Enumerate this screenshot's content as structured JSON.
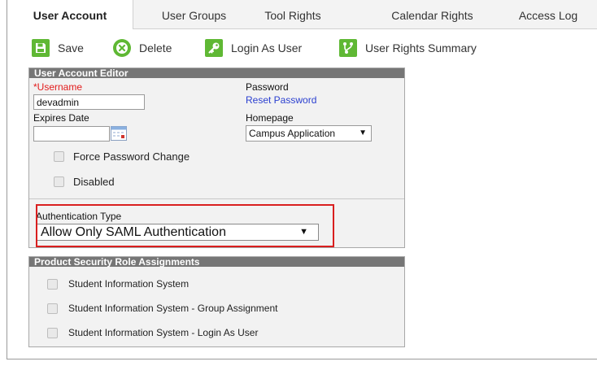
{
  "tabs": [
    {
      "label": "User Account",
      "active": true
    },
    {
      "label": "User Groups",
      "active": false
    },
    {
      "label": "Tool Rights",
      "active": false
    },
    {
      "label": "Calendar Rights",
      "active": false
    },
    {
      "label": "Access Log",
      "active": false
    }
  ],
  "toolbar": {
    "save": {
      "label": "Save",
      "icon": "save-icon"
    },
    "delete": {
      "label": "Delete",
      "icon": "delete-icon"
    },
    "login_as_user": {
      "label": "Login As User",
      "icon": "key-icon"
    },
    "user_rights_summary": {
      "label": "User Rights Summary",
      "icon": "branch-icon"
    }
  },
  "editor": {
    "title": "User Account Editor",
    "username": {
      "required_mark": "*",
      "label": "Username",
      "value": "devadmin"
    },
    "password": {
      "label": "Password",
      "reset_link": "Reset Password"
    },
    "expires": {
      "label": "Expires Date",
      "value": ""
    },
    "homepage": {
      "label": "Homepage",
      "selected": "Campus Application"
    },
    "force_password_change": {
      "label": "Force Password Change",
      "checked": false
    },
    "disabled": {
      "label": "Disabled",
      "checked": false
    },
    "authentication": {
      "label": "Authentication Type",
      "selected": "Allow Only SAML Authentication"
    }
  },
  "roles": {
    "title": "Product Security Role Assignments",
    "items": [
      {
        "label": "Student Information System",
        "checked": false
      },
      {
        "label": "Student Information System - Group Assignment",
        "checked": false
      },
      {
        "label": "Student Information System - Login As User",
        "checked": false
      }
    ]
  },
  "colors": {
    "accent_green": "#5fb834",
    "header_gray": "#767676",
    "highlight_red": "#d91f1f",
    "link_blue": "#2a3fd0",
    "required_red": "#e21c1c"
  }
}
